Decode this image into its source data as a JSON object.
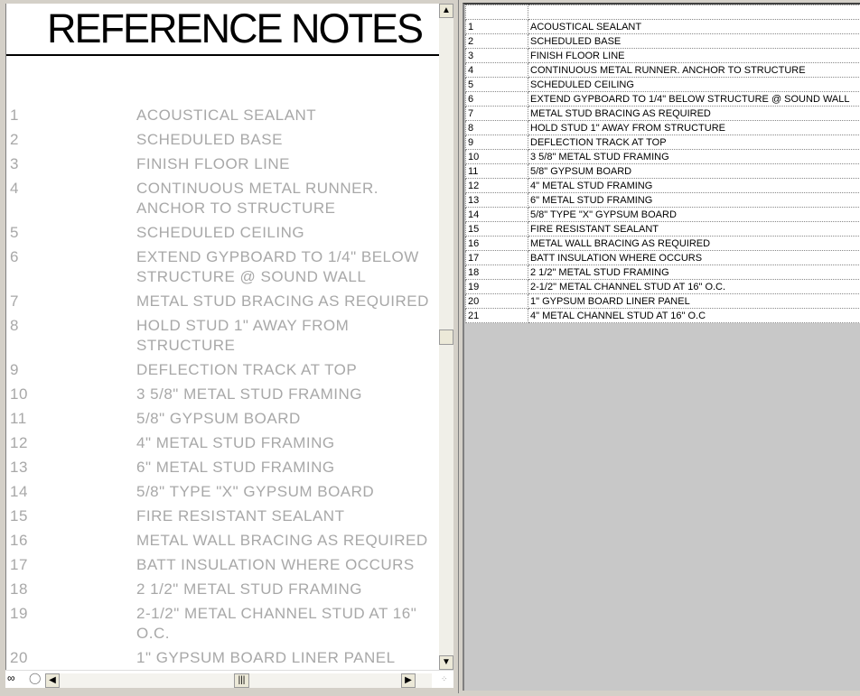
{
  "title": "REFERENCE NOTES",
  "notes": [
    {
      "num": "1",
      "text": "ACOUSTICAL SEALANT"
    },
    {
      "num": "2",
      "text": "SCHEDULED BASE"
    },
    {
      "num": "3",
      "text": "FINISH FLOOR LINE"
    },
    {
      "num": "4",
      "text": "CONTINUOUS METAL RUNNER. ANCHOR TO STRUCTURE"
    },
    {
      "num": "5",
      "text": "SCHEDULED CEILING"
    },
    {
      "num": "6",
      "text": "EXTEND GYPBOARD TO 1/4\" BELOW STRUCTURE @ SOUND WALL"
    },
    {
      "num": "7",
      "text": "METAL STUD BRACING AS REQUIRED"
    },
    {
      "num": "8",
      "text": "HOLD STUD 1\" AWAY FROM STRUCTURE"
    },
    {
      "num": "9",
      "text": "DEFLECTION TRACK AT TOP"
    },
    {
      "num": "10",
      "text": "3 5/8\" METAL STUD FRAMING"
    },
    {
      "num": "11",
      "text": "5/8\" GYPSUM BOARD"
    },
    {
      "num": "12",
      "text": "4\" METAL STUD FRAMING"
    },
    {
      "num": "13",
      "text": "6\" METAL STUD FRAMING"
    },
    {
      "num": "14",
      "text": "5/8\" TYPE \"X\" GYPSUM BOARD"
    },
    {
      "num": "15",
      "text": "FIRE RESISTANT SEALANT"
    },
    {
      "num": "16",
      "text": "METAL WALL BRACING AS REQUIRED"
    },
    {
      "num": "17",
      "text": "BATT INSULATION WHERE OCCURS"
    },
    {
      "num": "18",
      "text": "2 1/2\" METAL STUD FRAMING"
    },
    {
      "num": "19",
      "text": "2-1/2\" METAL CHANNEL STUD AT 16\" O.C."
    },
    {
      "num": "20",
      "text": "1\" GYPSUM BOARD LINER PANEL"
    },
    {
      "num": "21",
      "text": "4\" METAL CHANNEL STUD AT 16\" O.C"
    }
  ]
}
